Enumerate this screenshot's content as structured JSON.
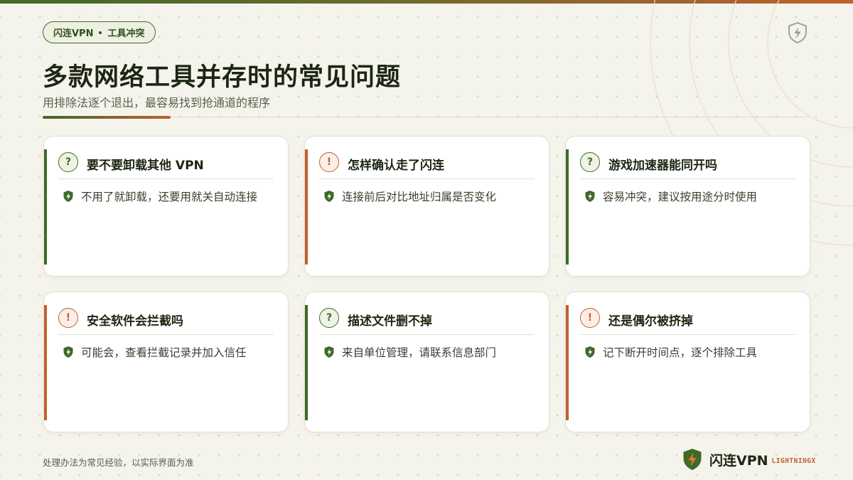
{
  "tag": {
    "brand": "闪连VPN",
    "topic": "工具冲突"
  },
  "header": {
    "title": "多款网络工具并存时的常见问题",
    "subtitle": "用排除法逐个退出，最容易找到抢通道的程序"
  },
  "cards": [
    {
      "type": "question",
      "badge": "?",
      "accent": "#3f6a28",
      "title": "要不要卸载其他 VPN",
      "answer": "不用了就卸载，还要用就关自动连接"
    },
    {
      "type": "warning",
      "badge": "!",
      "accent": "#c0602e",
      "title": "怎样确认走了闪连",
      "answer": "连接前后对比地址归属是否变化"
    },
    {
      "type": "question",
      "badge": "?",
      "accent": "#3f6a28",
      "title": "游戏加速器能同开吗",
      "answer": "容易冲突，建议按用途分时使用"
    },
    {
      "type": "warning",
      "badge": "!",
      "accent": "#c0602e",
      "title": "安全软件会拦截吗",
      "answer": "可能会，查看拦截记录并加入信任"
    },
    {
      "type": "question",
      "badge": "?",
      "accent": "#3f6a28",
      "title": "描述文件删不掉",
      "answer": "来自单位管理，请联系信息部门"
    },
    {
      "type": "warning",
      "badge": "!",
      "accent": "#c0602e",
      "title": "还是偶尔被挤掉",
      "answer": "记下断开时间点，逐个排除工具"
    }
  ],
  "footer": {
    "note": "处理办法为常见经验，以实际界面为准",
    "brand_name": "闪连VPN",
    "brand_en": "LIGHTNINGX"
  },
  "icons": {
    "top_right": "shield-lightning-icon",
    "answer": "shield-check-icon",
    "brand_logo": "shield-lightning-logo"
  },
  "colors": {
    "primary_green": "#3f6a28",
    "accent_orange": "#c0602e",
    "background": "#f5f4ec"
  }
}
